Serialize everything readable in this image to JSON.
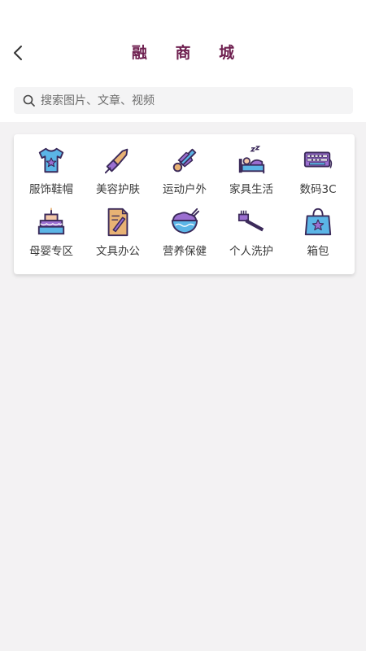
{
  "header": {
    "title": "融 商 城",
    "back_icon": "chevron-left-icon"
  },
  "search": {
    "placeholder": "搜索图片、文章、视频",
    "icon": "search-icon"
  },
  "categories": [
    {
      "label": "服饰鞋帽",
      "icon": "tshirt-icon"
    },
    {
      "label": "美容护肤",
      "icon": "lipstick-icon"
    },
    {
      "label": "运动户外",
      "icon": "shuttlecock-icon"
    },
    {
      "label": "家具生活",
      "icon": "bed-icon"
    },
    {
      "label": "数码3C",
      "icon": "keyboard-icon"
    },
    {
      "label": "母婴专区",
      "icon": "cake-icon"
    },
    {
      "label": "文具办公",
      "icon": "document-icon"
    },
    {
      "label": "营养保健",
      "icon": "bowl-icon"
    },
    {
      "label": "个人洗护",
      "icon": "toothbrush-icon"
    },
    {
      "label": "箱包",
      "icon": "shopping-bag-icon"
    }
  ],
  "colors": {
    "title": "#6e1f4f",
    "icon_outline": "#3b2a5a",
    "icon_purple": "#9b6fd1",
    "icon_blue": "#5bb5e6",
    "icon_orange": "#e8b274",
    "icon_peach": "#f3c8a8"
  }
}
